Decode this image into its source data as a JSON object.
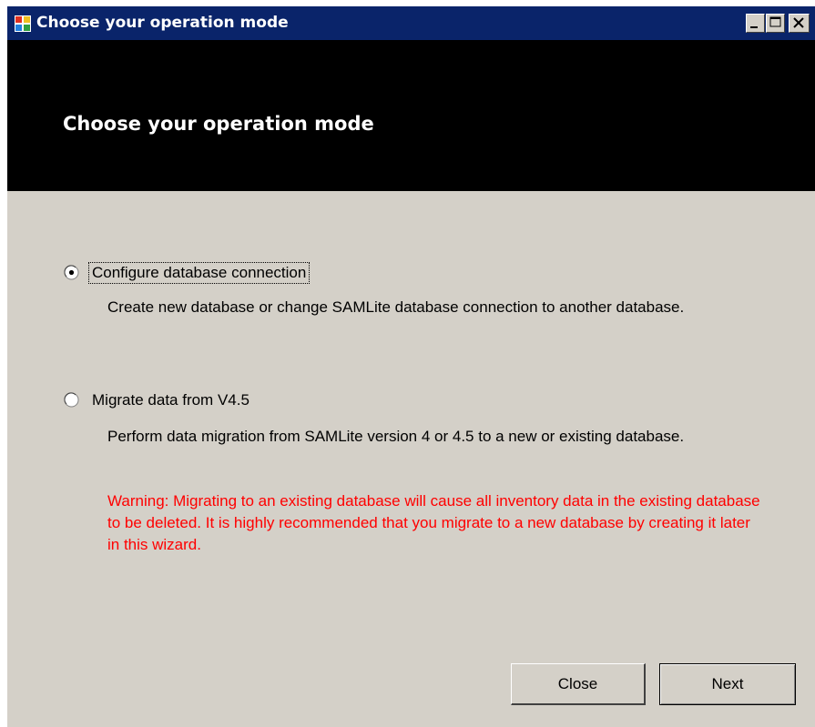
{
  "window": {
    "title": "Choose your operation mode",
    "icon": "app-icon",
    "controls": {
      "minimize_icon": "minimize-icon",
      "maximize_icon": "maximize-icon",
      "close_icon": "close-icon"
    }
  },
  "header": {
    "title": "Choose your operation mode"
  },
  "options": [
    {
      "label": "Configure database connection",
      "description": "Create new database or change SAMLite database connection to another database.",
      "selected": true
    },
    {
      "label": "Migrate data from V4.5",
      "description": "Perform data migration from SAMLite version 4 or 4.5 to a new or existing database.",
      "selected": false
    }
  ],
  "warning": {
    "text": "Warning: Migrating to an existing database will cause all inventory data in the existing database to be deleted. It is highly recommended that you migrate to a new database by creating it later in this wizard.",
    "color": "#ff0000"
  },
  "buttons": {
    "close_label": "Close",
    "next_label": "Next"
  },
  "colors": {
    "titlebar": "#0a246a",
    "banner": "#000000",
    "dialog_face": "#d4d0c8"
  }
}
